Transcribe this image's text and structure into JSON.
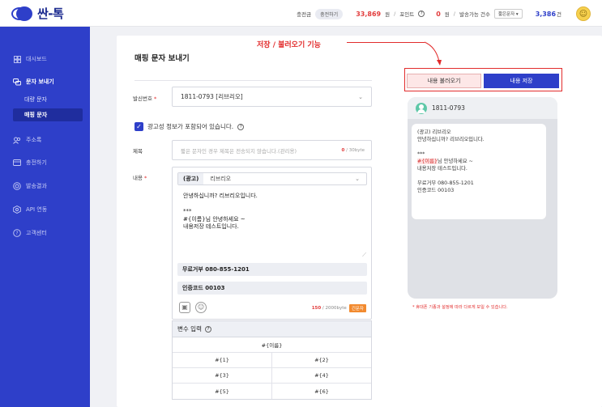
{
  "header": {
    "logo_text": "싼-톡",
    "balance_label": "충전금",
    "charge_button": "충전하기",
    "balance_amount": "33,869",
    "won": "원",
    "point_label": "포인트",
    "point_amount": "0",
    "point_unit": "원",
    "sendable_label": "발송가능 건수",
    "msg_type_select": "짧은문자",
    "sendable_count": "3,386",
    "sendable_unit": "건",
    "divider": "/"
  },
  "sidebar": {
    "items": [
      {
        "label": "대시보드",
        "icon": "dashboard-icon"
      },
      {
        "label": "문자 보내기",
        "icon": "message-icon"
      },
      {
        "label": "주소록",
        "icon": "contacts-icon"
      },
      {
        "label": "충전하기",
        "icon": "card-icon"
      },
      {
        "label": "발송결과",
        "icon": "result-icon"
      },
      {
        "label": "API 연동",
        "icon": "api-icon"
      },
      {
        "label": "고객센터",
        "icon": "help-icon"
      }
    ],
    "sub_items": [
      {
        "label": "대량 문자"
      },
      {
        "label": "매핑 문자"
      }
    ]
  },
  "annotation": {
    "text": "저장 / 불러오기 기능"
  },
  "form": {
    "page_title": "매핑 문자 보내기",
    "sender_label": "발신번호",
    "sender_value": "1811-0793 [리브리오]",
    "ad_check_label": "광고성 정보가 포함되어 있습니다.",
    "subject_label": "제목",
    "subject_placeholder": "짧은 문자인 경우 제목은 전송되지 않습니다.(관리용)",
    "subject_count": "0",
    "subject_max": "/ 30byte",
    "content_label": "내용",
    "required_mark": "*",
    "ad_tag": "(광고)",
    "ad_name": "리브리오",
    "message_body": "안녕하십니까? 리브리오입니다.\n\n***\n#{이름}님 안녕하세요 ~\n내용저장 테스트입니다.",
    "reject_line": "무료거부 080-855-1201",
    "auth_line": "인증코드 00103",
    "byte_count": "150",
    "byte_max": "/ 2000byte",
    "lms_badge": "긴문자"
  },
  "variables": {
    "header": "변수 입력",
    "rows": [
      [
        "#{이름}"
      ],
      [
        "#{1}",
        "#{2}"
      ],
      [
        "#{3}",
        "#{4}"
      ],
      [
        "#{5}",
        "#{6}"
      ]
    ]
  },
  "preview": {
    "load_button": "내용 불러오기",
    "save_button": "내용 저장",
    "sender_number": "1811-0793",
    "lines": [
      "(광고) 리브리오",
      "안녕하십니까? 리브리오입니다.",
      "",
      "***",
      "#{이름}님 안녕하세요 ~",
      "내용저장 테스트입니다.",
      "",
      "무료거부 080-855-1201",
      "인증코드 00103"
    ],
    "highlight_token": "#{이름}",
    "note": "* 휴대폰 기종과 설정에 따라 다르게 보일 수 있습니다."
  },
  "colors": {
    "brand": "#2e3fc9",
    "accent_red": "#e22c2c",
    "badge_orange": "#f28a2f"
  }
}
